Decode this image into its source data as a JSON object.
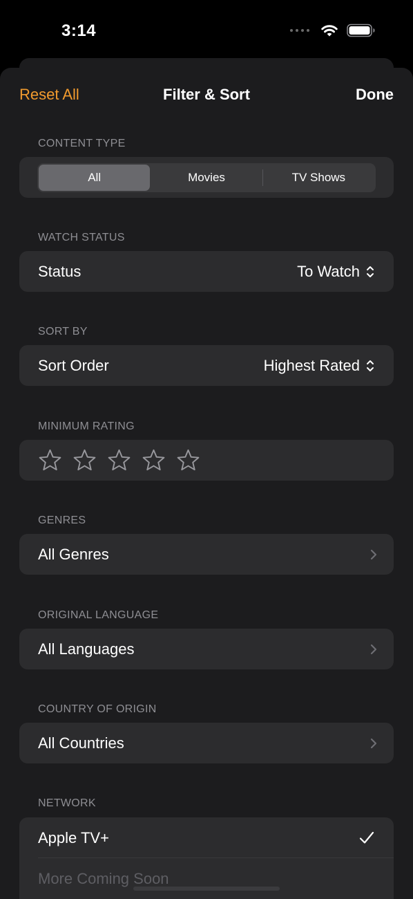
{
  "status_bar": {
    "time": "3:14"
  },
  "nav": {
    "reset_label": "Reset All",
    "title": "Filter & Sort",
    "done_label": "Done"
  },
  "content_type": {
    "header": "CONTENT TYPE",
    "options": [
      "All",
      "Movies",
      "TV Shows"
    ],
    "selected": "All"
  },
  "watch_status": {
    "header": "WATCH STATUS",
    "label": "Status",
    "value": "To Watch"
  },
  "sort_by": {
    "header": "SORT BY",
    "label": "Sort Order",
    "value": "Highest Rated"
  },
  "minimum_rating": {
    "header": "MINIMUM RATING",
    "rating": 0,
    "max": 5
  },
  "genres": {
    "header": "GENRES",
    "value": "All Genres"
  },
  "original_language": {
    "header": "ORIGINAL LANGUAGE",
    "value": "All Languages"
  },
  "country_of_origin": {
    "header": "COUNTRY OF ORIGIN",
    "value": "All Countries"
  },
  "network": {
    "header": "NETWORK",
    "items": [
      {
        "label": "Apple TV+",
        "checked": true
      },
      {
        "label": "More Coming Soon",
        "disabled": true
      }
    ]
  },
  "colors": {
    "accent": "#f29b2e",
    "sheet_background": "#1c1c1e",
    "card_background": "#2c2c2e",
    "secondary_text": "#8e8e93"
  },
  "icons": {
    "wifi": "wifi-icon",
    "battery": "battery-icon",
    "updown": "chevron-up-down-icon",
    "chevron": "chevron-right-icon",
    "star": "star-outline-icon",
    "check": "checkmark-icon"
  }
}
